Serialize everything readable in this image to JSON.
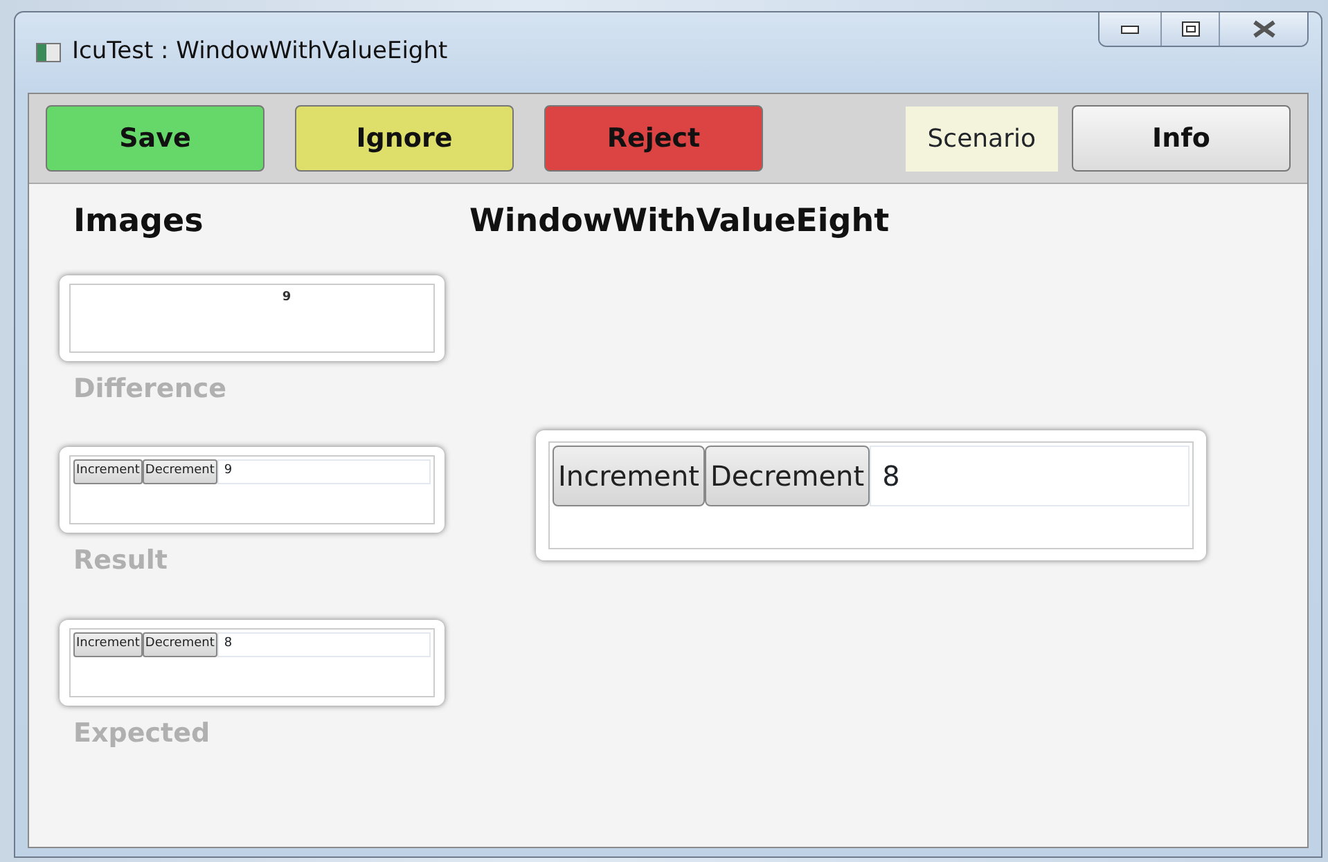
{
  "window": {
    "title": "IcuTest : WindowWithValueEight"
  },
  "toolbar": {
    "buttons": [
      {
        "label": "Save",
        "kind": "save"
      },
      {
        "label": "Ignore",
        "kind": "ignore"
      },
      {
        "label": "Reject",
        "kind": "reject"
      }
    ],
    "scenario": "Scenario",
    "info": "Info"
  },
  "images": {
    "heading": "Images",
    "items": [
      {
        "kind": "difference",
        "mark": "9",
        "caption": "Difference"
      },
      {
        "kind": "app",
        "buttons": [
          "Increment",
          "Decrement"
        ],
        "value": "9",
        "caption": "Result"
      },
      {
        "kind": "app",
        "buttons": [
          "Increment",
          "Decrement"
        ],
        "value": "8",
        "caption": "Expected"
      }
    ]
  },
  "preview": {
    "title": "WindowWithValueEight",
    "buttons": [
      "Increment",
      "Decrement"
    ],
    "value": "8"
  }
}
